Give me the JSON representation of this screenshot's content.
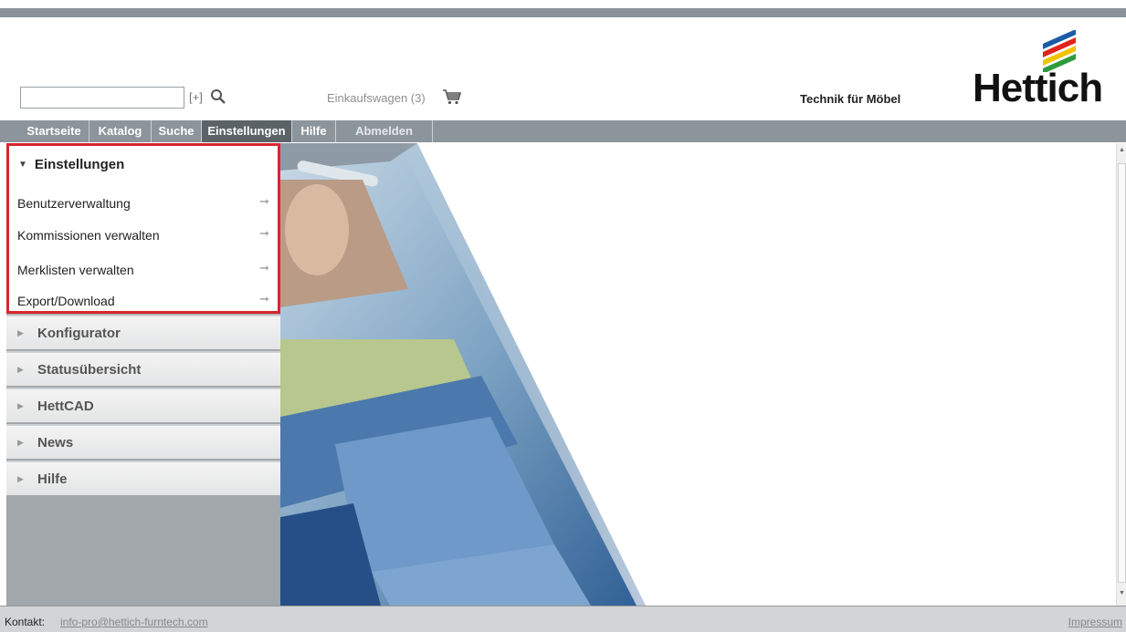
{
  "header": {
    "search": {
      "value": "",
      "placeholder": ""
    },
    "advanced_search_label": "[+]",
    "search_icon": "magnifier-icon",
    "cart_label": "Einkaufswagen (3)",
    "cart_icon": "shopping-cart-icon",
    "tagline": "Technik für Möbel",
    "logo_text": "Hettich",
    "logo_colors": [
      "#2e9b3c",
      "#f2c200",
      "#e2231a",
      "#1d5aa7"
    ]
  },
  "nav": {
    "items": [
      {
        "label": "Startseite"
      },
      {
        "label": "Katalog"
      },
      {
        "label": "Suche"
      },
      {
        "label": "Einstellungen"
      },
      {
        "label": "Hilfe"
      },
      {
        "label": "Abmelden"
      }
    ],
    "active": "Einstellungen"
  },
  "sidebar": {
    "settings": {
      "title": "Einstellungen",
      "expanded": true,
      "items": [
        {
          "label": "Benutzerverwaltung",
          "icon": "arrow-right-icon"
        },
        {
          "label": "Kommissionen verwalten",
          "icon": "arrow-right-icon"
        },
        {
          "label": "Merklisten verwalten",
          "icon": "arrow-right-icon"
        },
        {
          "label": "Export/Download",
          "icon": "arrow-right-icon"
        }
      ]
    },
    "sections": [
      {
        "label": "Konfigurator"
      },
      {
        "label": "Statusübersicht"
      },
      {
        "label": "HettCAD"
      },
      {
        "label": "News"
      },
      {
        "label": "Hilfe"
      }
    ]
  },
  "footer": {
    "contact_label": "Kontakt:",
    "contact_email": "info-pro@hettich-furntech.com",
    "impressum": "Impressum"
  },
  "colors": {
    "nav_bg": "#8c959b",
    "nav_active": "#5b6367",
    "highlight_border": "#d8262e",
    "sidebar_bg": "#a1a7aa"
  }
}
